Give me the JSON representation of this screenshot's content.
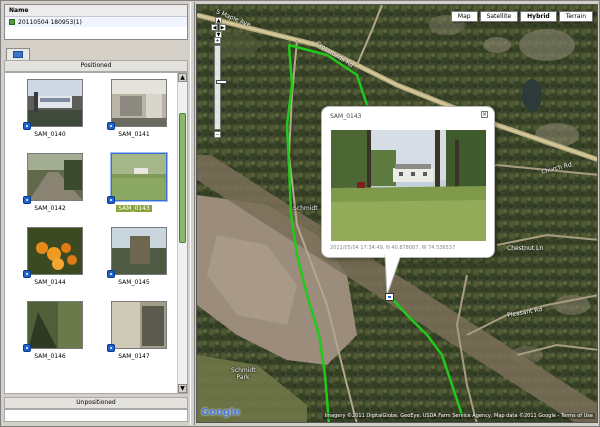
{
  "tree": {
    "header": "Name",
    "item": "20110504 180953(1)"
  },
  "positioned_label": "Positioned",
  "unpositioned_label": "Unpositioned",
  "photos": [
    {
      "label": "SAM_0140",
      "selected": false
    },
    {
      "label": "SAM_0141",
      "selected": false
    },
    {
      "label": "SAM_0142",
      "selected": false
    },
    {
      "label": "SAM_0143",
      "selected": true
    },
    {
      "label": "SAM_0144",
      "selected": false
    },
    {
      "label": "SAM_0145",
      "selected": false
    },
    {
      "label": "SAM_0146",
      "selected": false
    },
    {
      "label": "SAM_0147",
      "selected": false
    }
  ],
  "map": {
    "type_buttons": [
      "Map",
      "Satellite",
      "Hybrid",
      "Terrain"
    ],
    "active_type": "Hybrid",
    "popup_title": "SAM_0143",
    "popup_meta": "2011/05/04 17:34:49, N 40.878087, W 74.536537",
    "place_label": "Schmidt",
    "park_label": "Schmidt Park",
    "roads": [
      "S Maple Ave",
      "Crossroads Rd",
      "Chestnut Ln",
      "Church Rd",
      "Pleasant Rd",
      "Crossroads Rd"
    ],
    "logo": "Google",
    "credit": "Imagery ©2011 DigitalGlobe, GeoEye, USDA Farm Service Agency, Map data ©2011 Google - Terms of Use"
  },
  "colors": {
    "track": "#22c81a",
    "forest": "#3f4a2c",
    "clearing": "#9a8a78"
  }
}
